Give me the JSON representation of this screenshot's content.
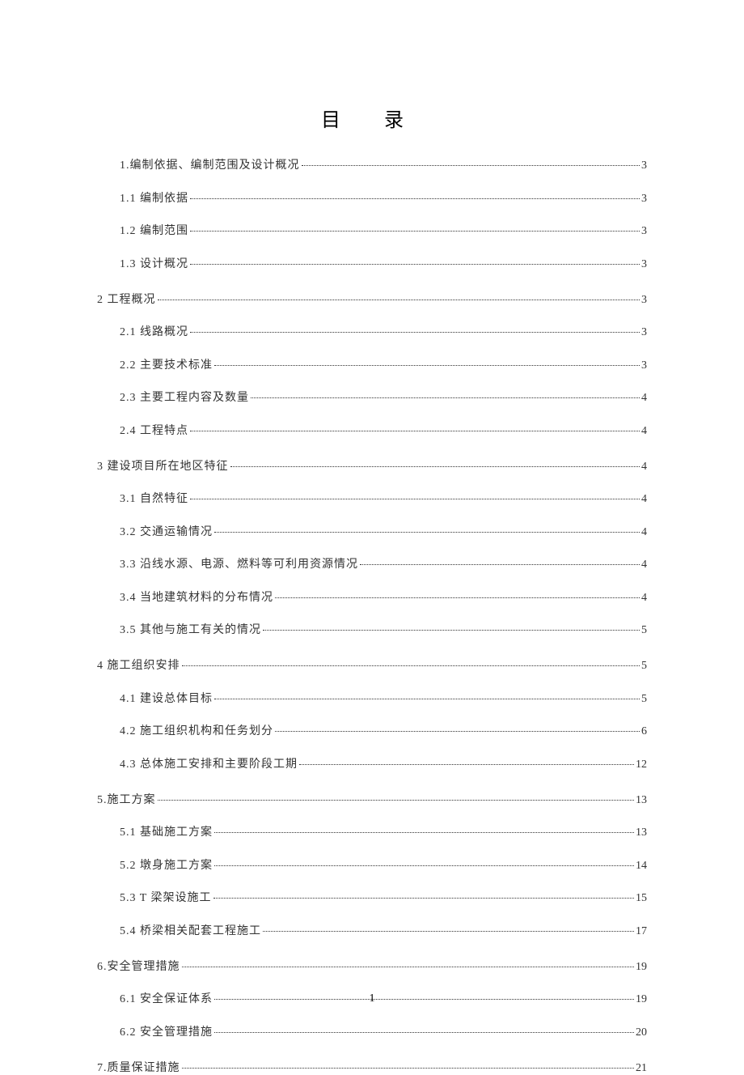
{
  "title": "目 录",
  "page_number": "1",
  "toc": [
    {
      "level": 2,
      "label": "1.编制依据、编制范围及设计概况",
      "page": "3",
      "gap": false
    },
    {
      "level": 2,
      "label": "1.1 编制依据",
      "page": "3",
      "gap": false
    },
    {
      "level": 2,
      "label": "1.2 编制范围",
      "page": "3",
      "gap": false
    },
    {
      "level": 2,
      "label": "1.3 设计概况",
      "page": "3",
      "gap": false
    },
    {
      "level": 1,
      "label": "2 工程概况",
      "page": "3",
      "gap": true
    },
    {
      "level": 2,
      "label": "2.1 线路概况",
      "page": "3",
      "gap": false
    },
    {
      "level": 2,
      "label": "2.2 主要技术标准",
      "page": "3",
      "gap": false
    },
    {
      "level": 2,
      "label": "2.3 主要工程内容及数量",
      "page": "4",
      "gap": false
    },
    {
      "level": 2,
      "label": "2.4 工程特点",
      "page": "4",
      "gap": false
    },
    {
      "level": 1,
      "label": "3 建设项目所在地区特征",
      "page": "4",
      "gap": true
    },
    {
      "level": 2,
      "label": "3.1 自然特征",
      "page": "4",
      "gap": false
    },
    {
      "level": 2,
      "label": "3.2 交通运输情况",
      "page": "4",
      "gap": false
    },
    {
      "level": 2,
      "label": "3.3 沿线水源、电源、燃料等可利用资源情况",
      "page": "4",
      "gap": false
    },
    {
      "level": 2,
      "label": "3.4 当地建筑材料的分布情况",
      "page": "4",
      "gap": false
    },
    {
      "level": 2,
      "label": "3.5 其他与施工有关的情况",
      "page": "5",
      "gap": false
    },
    {
      "level": 1,
      "label": "4 施工组织安排",
      "page": "5",
      "gap": true
    },
    {
      "level": 2,
      "label": "4.1 建设总体目标",
      "page": "5",
      "gap": false
    },
    {
      "level": 2,
      "label": "4.2 施工组织机构和任务划分",
      "page": "6",
      "gap": false
    },
    {
      "level": 2,
      "label": "4.3 总体施工安排和主要阶段工期",
      "page": "12",
      "gap": false
    },
    {
      "level": 1,
      "label": "5.施工方案",
      "page": "13",
      "gap": true
    },
    {
      "level": 2,
      "label": "5.1 基础施工方案",
      "page": "13",
      "gap": false
    },
    {
      "level": 2,
      "label": "5.2 墩身施工方案",
      "page": "14",
      "gap": false
    },
    {
      "level": 2,
      "label": "5.3 T 梁架设施工",
      "page": "15",
      "gap": false
    },
    {
      "level": 2,
      "label": "5.4 桥梁相关配套工程施工",
      "page": "17",
      "gap": false
    },
    {
      "level": 1,
      "label": "6.安全管理措施",
      "page": "19",
      "gap": true
    },
    {
      "level": 2,
      "label": "6.1 安全保证体系",
      "page": "19",
      "gap": false
    },
    {
      "level": 2,
      "label": "6.2 安全管理措施",
      "page": "20",
      "gap": false
    },
    {
      "level": 1,
      "label": "7.质量保证措施",
      "page": "21",
      "gap": true
    }
  ]
}
